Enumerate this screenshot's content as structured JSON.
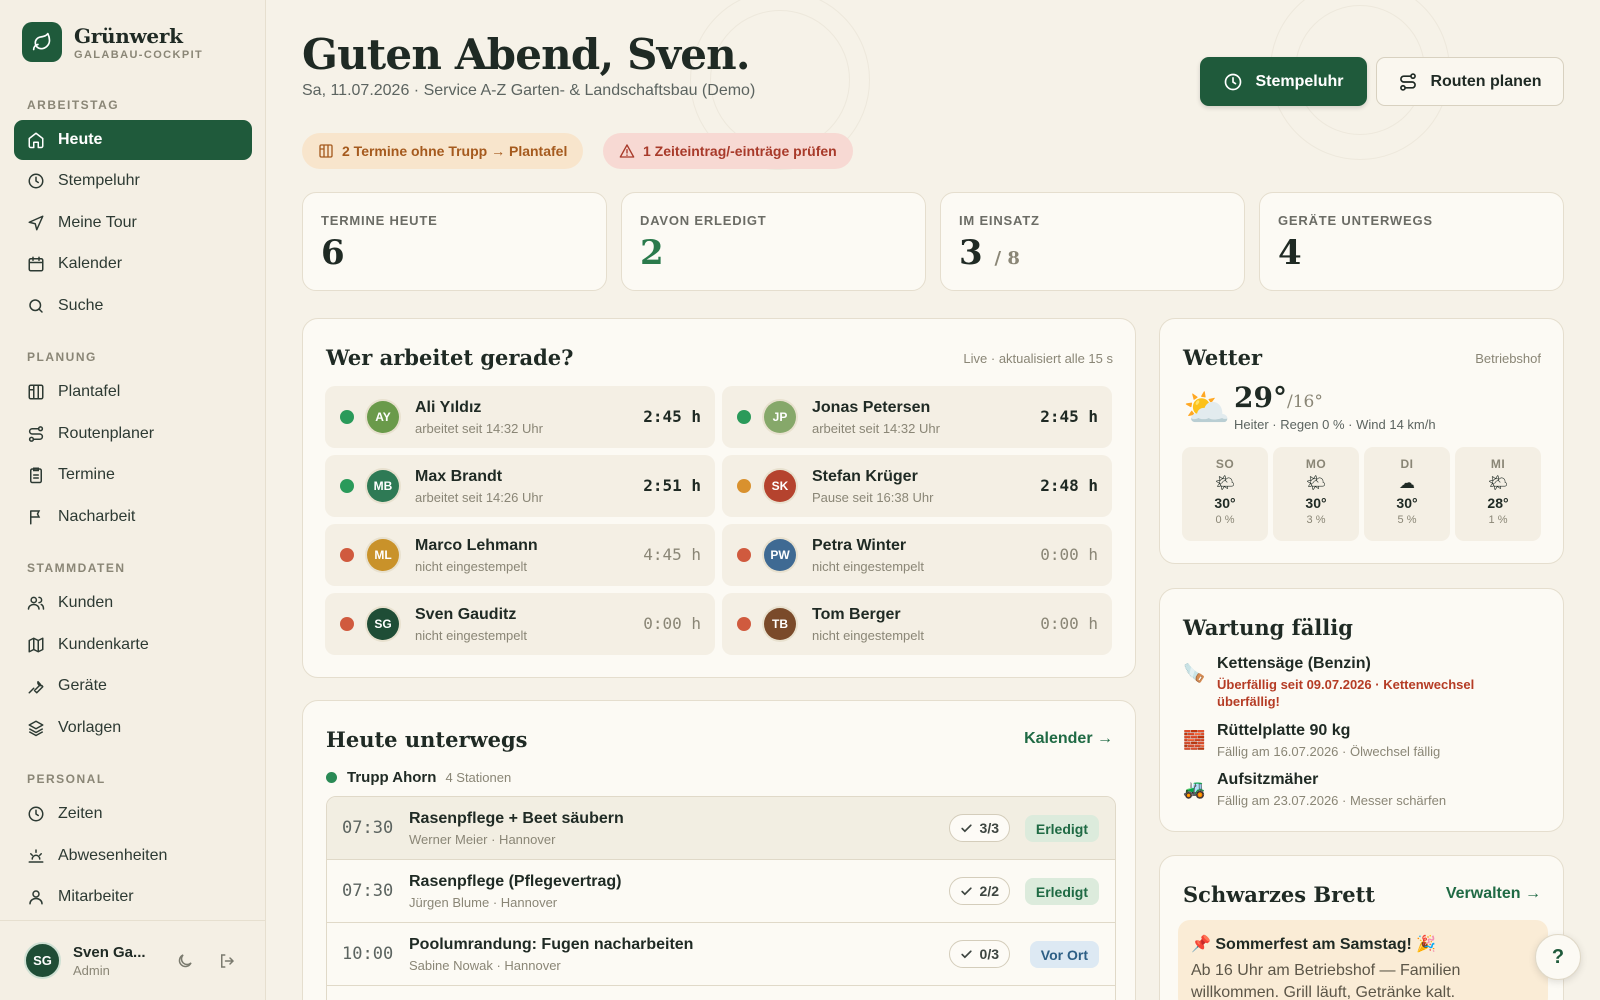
{
  "brand": {
    "name": "Grünwerk",
    "subtitle": "GALABAU-COCKPIT"
  },
  "sidebar": {
    "sections": [
      {
        "label": "ARBEITSTAG"
      },
      {
        "label": "PLANUNG"
      },
      {
        "label": "STAMMDATEN"
      },
      {
        "label": "PERSONAL"
      }
    ],
    "items": [
      {
        "label": "Heute",
        "icon": "home-icon",
        "active": true
      },
      {
        "label": "Stempeluhr",
        "icon": "clock-icon"
      },
      {
        "label": "Meine Tour",
        "icon": "send-icon"
      },
      {
        "label": "Kalender",
        "icon": "calendar-icon"
      },
      {
        "label": "Suche",
        "icon": "search-icon"
      },
      {
        "label": "Plantafel",
        "icon": "board-icon"
      },
      {
        "label": "Routenplaner",
        "icon": "route-icon"
      },
      {
        "label": "Termine",
        "icon": "clipboard-icon"
      },
      {
        "label": "Nacharbeit",
        "icon": "flag-icon"
      },
      {
        "label": "Kunden",
        "icon": "users-icon"
      },
      {
        "label": "Kundenkarte",
        "icon": "map-icon"
      },
      {
        "label": "Geräte",
        "icon": "wrench-icon"
      },
      {
        "label": "Vorlagen",
        "icon": "layers-icon"
      },
      {
        "label": "Zeiten",
        "icon": "clock-icon"
      },
      {
        "label": "Abwesenheiten",
        "icon": "sun-horizon-icon"
      },
      {
        "label": "Mitarbeiter",
        "icon": "user-icon"
      }
    ],
    "user": {
      "initials": "SG",
      "name": "Sven Ga...",
      "role": "Admin"
    }
  },
  "header": {
    "greeting": "Guten Abend, Sven.",
    "subtitle": "Sa, 11.07.2026 · Service A-Z Garten- & Landschaftsbau (Demo)",
    "primary_button": "Stempeluhr",
    "secondary_button": "Routen planen"
  },
  "alerts": {
    "unassigned": "2 Termine ohne Trupp → Plantafel",
    "time_entries": "1 Zeiteintrag/-einträge prüfen"
  },
  "stats": [
    {
      "label": "TERMINE HEUTE",
      "value": "6",
      "suffix": ""
    },
    {
      "label": "DAVON ERLEDIGT",
      "value": "2",
      "suffix": ""
    },
    {
      "label": "IM EINSATZ",
      "value": "3",
      "suffix": "/ 8"
    },
    {
      "label": "GERÄTE UNTERWEGS",
      "value": "4",
      "suffix": ""
    }
  ],
  "workers": {
    "title": "Wer arbeitet gerade?",
    "meta": "Live · aktualisiert alle 15 s",
    "list": [
      {
        "initials": "AY",
        "name": "Ali Yıldız",
        "status": "arbeitet seit 14:32 Uhr",
        "time": "2:45 h",
        "state": "working",
        "color": "#6a9a4a"
      },
      {
        "initials": "JP",
        "name": "Jonas Petersen",
        "status": "arbeitet seit 14:32 Uhr",
        "time": "2:45 h",
        "state": "working",
        "color": "#86a86a"
      },
      {
        "initials": "MB",
        "name": "Max Brandt",
        "status": "arbeitet seit 14:26 Uhr",
        "time": "2:51 h",
        "state": "working",
        "color": "#2e7a55"
      },
      {
        "initials": "SK",
        "name": "Stefan Krüger",
        "status": "Pause seit 16:38 Uhr",
        "time": "2:48 h",
        "state": "pause",
        "color": "#b5432e"
      },
      {
        "initials": "ML",
        "name": "Marco Lehmann",
        "status": "nicht eingestempelt",
        "time": "4:45 h",
        "state": "off",
        "color": "#c9922a"
      },
      {
        "initials": "PW",
        "name": "Petra Winter",
        "status": "nicht eingestempelt",
        "time": "0:00 h",
        "state": "off",
        "color": "#3f6a93"
      },
      {
        "initials": "SG",
        "name": "Sven Gauditz",
        "status": "nicht eingestempelt",
        "time": "0:00 h",
        "state": "off",
        "color": "#1f4d36"
      },
      {
        "initials": "TB",
        "name": "Tom Berger",
        "status": "nicht eingestempelt",
        "time": "0:00 h",
        "state": "off",
        "color": "#7a4a2a"
      }
    ],
    "state_colors": {
      "working": "#2a9a5a",
      "pause": "#d9912e",
      "off": "#d05a3e"
    }
  },
  "weather": {
    "title": "Wetter",
    "location": "Betriebshof",
    "temp": "29°",
    "temp_low": "/16°",
    "description": "Heiter · Regen 0 % · Wind 14 km/h",
    "icon": "⛅",
    "forecast": [
      {
        "day": "SO",
        "icon": "🌤",
        "temp": "30°",
        "rain": "0 %"
      },
      {
        "day": "MO",
        "icon": "🌤",
        "temp": "30°",
        "rain": "3 %"
      },
      {
        "day": "DI",
        "icon": "☁",
        "temp": "30°",
        "rain": "5 %"
      },
      {
        "day": "MI",
        "icon": "🌤",
        "temp": "28°",
        "rain": "1 %"
      }
    ]
  },
  "maintenance": {
    "title": "Wartung fällig",
    "items": [
      {
        "icon": "🪚",
        "name": "Kettensäge (Benzin)",
        "detail": "Überfällig seit 09.07.2026 · Kettenwechsel überfällig!",
        "overdue": true
      },
      {
        "icon": "🧱",
        "name": "Rüttelplatte 90 kg",
        "detail": "Fällig am 16.07.2026 · Ölwechsel fällig",
        "overdue": false
      },
      {
        "icon": "🚜",
        "name": "Aufsitzmäher",
        "detail": "Fällig am 23.07.2026 · Messer schärfen",
        "overdue": false
      }
    ]
  },
  "today": {
    "title": "Heute unterwegs",
    "link": "Kalender →",
    "trupp": {
      "name": "Trupp Ahorn",
      "count": "4 Stationen"
    },
    "stops": [
      {
        "time": "07:30",
        "title": "Rasenpflege + Beet säubern",
        "sub": "Werner Meier · Hannover",
        "check": "3/3",
        "status": "Erledigt",
        "status_type": "done"
      },
      {
        "time": "07:30",
        "title": "Rasenpflege (Pflegevertrag)",
        "sub": "Jürgen Blume · Hannover",
        "check": "2/2",
        "status": "Erledigt",
        "status_type": "done"
      },
      {
        "time": "10:00",
        "title": "Poolumrandung: Fugen nacharbeiten",
        "sub": "Sabine Nowak · Hannover",
        "check": "0/3",
        "status": "Vor Ort",
        "status_type": "vor"
      }
    ]
  },
  "board": {
    "title": "Schwarzes Brett",
    "link": "Verwalten →",
    "note_title": "📌 Sommerfest am Samstag! 🎉",
    "note_body": "Ab 16 Uhr am Betriebshof — Familien willkommen. Grill läuft, Getränke kalt."
  },
  "help": "?"
}
